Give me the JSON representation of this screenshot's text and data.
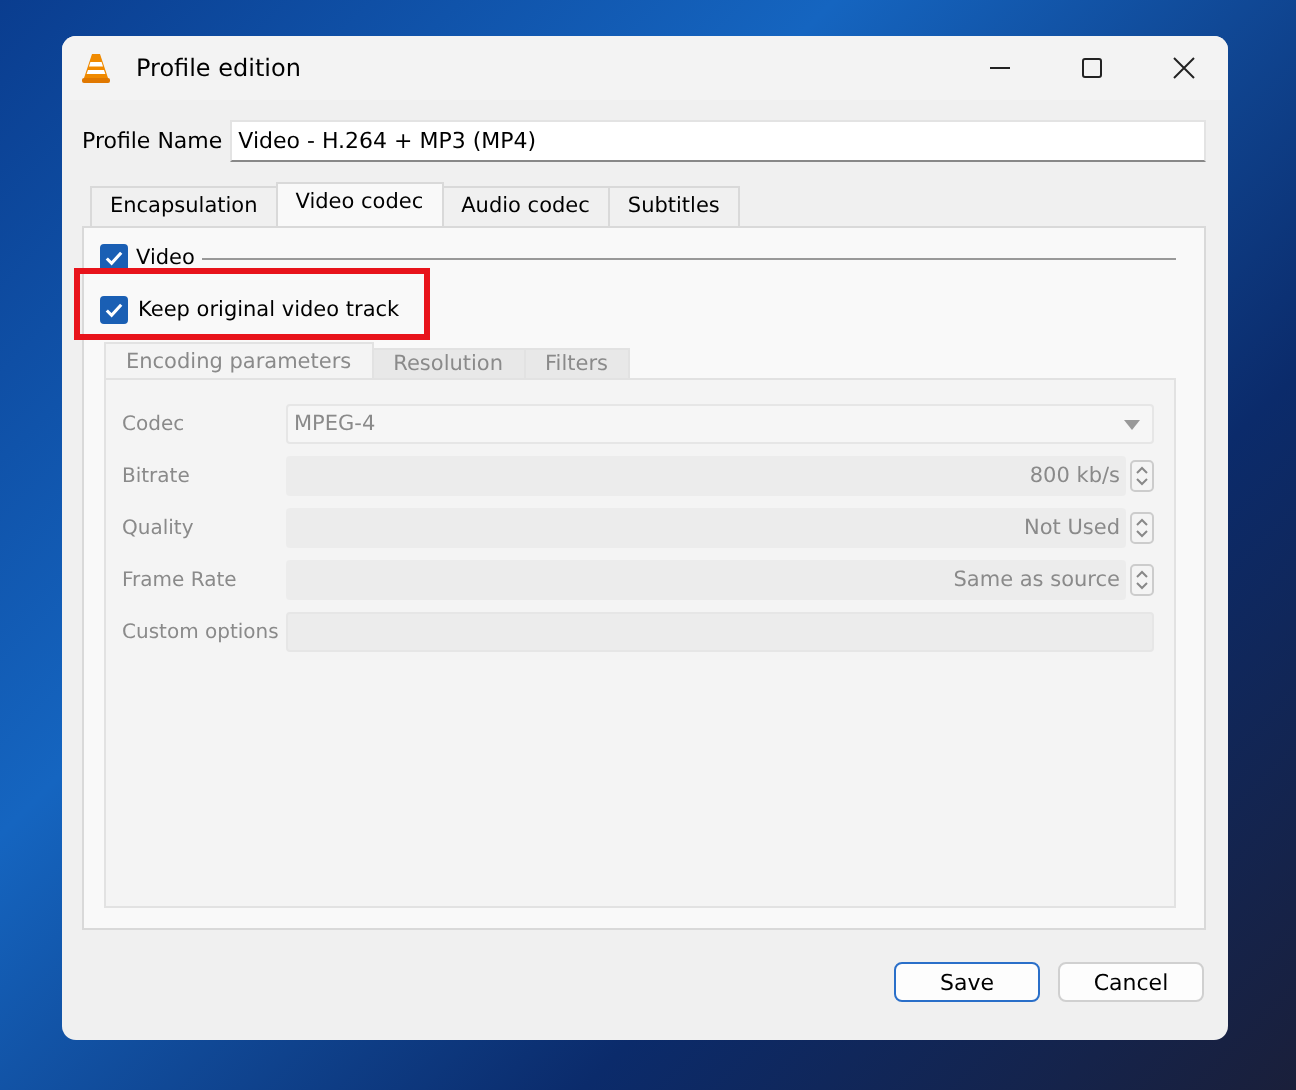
{
  "window": {
    "title": "Profile edition"
  },
  "profile_name": {
    "label": "Profile Name",
    "value": "Video - H.264 + MP3 (MP4)"
  },
  "tabs": [
    {
      "label": "Encapsulation",
      "selected": false
    },
    {
      "label": "Video codec",
      "selected": true
    },
    {
      "label": "Audio codec",
      "selected": false
    },
    {
      "label": "Subtitles",
      "selected": false
    }
  ],
  "video_group": {
    "label": "Video",
    "checked": true
  },
  "keep_original": {
    "label": "Keep original video track",
    "checked": true,
    "highlighted": true
  },
  "encoding": {
    "disabled": true,
    "tabs": [
      {
        "label": "Encoding parameters",
        "selected": true
      },
      {
        "label": "Resolution",
        "selected": false
      },
      {
        "label": "Filters",
        "selected": false
      }
    ],
    "fields": [
      {
        "kind": "dropdown",
        "label": "Codec",
        "value": "MPEG-4"
      },
      {
        "kind": "spinner",
        "label": "Bitrate",
        "value": "800 kb/s"
      },
      {
        "kind": "spinner",
        "label": "Quality",
        "value": "Not Used"
      },
      {
        "kind": "spinner",
        "label": "Frame Rate",
        "value": "Same as source"
      },
      {
        "kind": "text",
        "label": "Custom options"
      }
    ]
  },
  "buttons": [
    {
      "label": "Save",
      "default": true
    },
    {
      "label": "Cancel",
      "default": false
    }
  ]
}
